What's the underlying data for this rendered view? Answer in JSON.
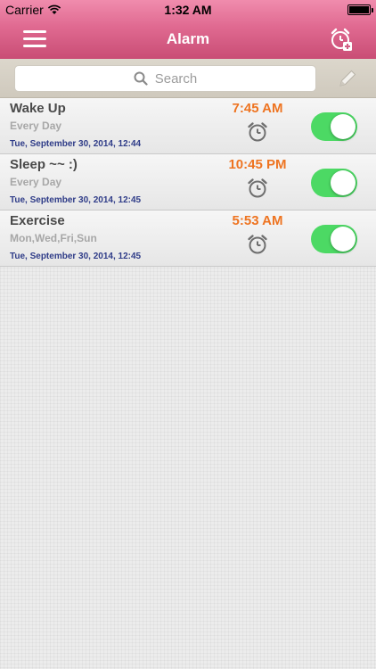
{
  "status_bar": {
    "carrier": "Carrier",
    "time": "1:32 AM",
    "icons": [
      "wifi-icon",
      "battery-icon"
    ]
  },
  "navbar": {
    "title": "Alarm",
    "left_icon": "menu-icon",
    "right_icon": "add-alarm-icon"
  },
  "search": {
    "placeholder": "Search",
    "icon": "search-icon",
    "edit_icon": "edit-icon"
  },
  "alarms": [
    {
      "name": "Wake Up",
      "repeat": "Every Day",
      "created": "Tue, September 30, 2014, 12:44",
      "time": "7:45 AM",
      "enabled": true
    },
    {
      "name": "Sleep ~~ :)",
      "repeat": "Every Day",
      "created": "Tue, September 30, 2014, 12:45",
      "time": "10:45 PM",
      "enabled": true
    },
    {
      "name": "Exercise",
      "repeat": "Mon,Wed,Fri,Sun",
      "created": "Tue, September 30, 2014, 12:45",
      "time": "5:53 AM",
      "enabled": true
    }
  ],
  "colors": {
    "header_pink": "#e06a91",
    "time_orange": "#ee7421",
    "date_blue": "#2f3c88",
    "toggle_green": "#4cd964"
  }
}
